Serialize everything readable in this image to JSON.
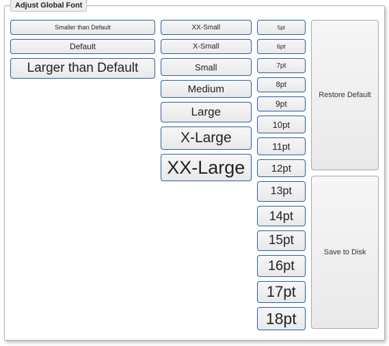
{
  "panel": {
    "title": "Adjust Global Font"
  },
  "relative": {
    "smaller": "Smaller than Default",
    "default": "Default",
    "larger": "Larger than Default"
  },
  "named": {
    "xxsmall": "XX-Small",
    "xsmall": "X-Small",
    "small": "Small",
    "medium": "Medium",
    "large": "Large",
    "xlarge": "X-Large",
    "xxlarge": "XX-Large"
  },
  "pt": {
    "p5": "5pt",
    "p6": "6pt",
    "p7": "7pt",
    "p8": "8pt",
    "p9": "9pt",
    "p10": "10pt",
    "p11": "11pt",
    "p12": "12pt",
    "p13": "13pt",
    "p14": "14pt",
    "p15": "15pt",
    "p16": "16pt",
    "p17": "17pt",
    "p18": "18pt"
  },
  "actions": {
    "restore": "Restore Default",
    "save": "Save to Disk"
  }
}
